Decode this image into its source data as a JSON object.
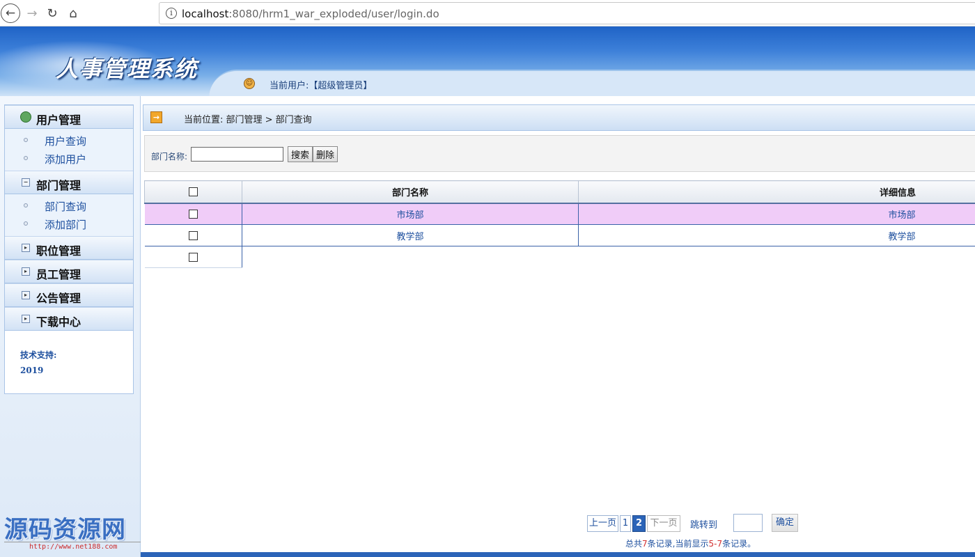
{
  "browser": {
    "url_host": "localhost",
    "url_rest": ":8080/hrm1_war_exploded/user/login.do",
    "info_icon": "i"
  },
  "header": {
    "system_title": "人事管理系统",
    "current_user": "当前用户:【超级管理员】"
  },
  "sidebar": {
    "groups": [
      {
        "label": "用户管理",
        "items": [
          "用户查询",
          "添加用户"
        ]
      },
      {
        "label": "部门管理",
        "items": [
          "部门查询",
          "添加部门"
        ]
      },
      {
        "label": "职位管理"
      },
      {
        "label": "员工管理"
      },
      {
        "label": "公告管理"
      },
      {
        "label": "下载中心"
      }
    ],
    "tech_label": "技术支持:",
    "tech_year": "2019"
  },
  "watermark": {
    "title": "源码资源网",
    "url": "http://www.net188.com"
  },
  "breadcrumb": {
    "text": "当前位置: 部门管理 > 部门查询"
  },
  "search": {
    "label": "部门名称:",
    "value": "",
    "search_button": "搜索",
    "delete_button": "删除"
  },
  "table": {
    "headers": [
      "部门名称",
      "详细信息"
    ],
    "rows": [
      {
        "name": "市场部",
        "detail": "市场部",
        "highlighted": true
      },
      {
        "name": "教学部",
        "detail": "教学部",
        "highlighted": false
      }
    ]
  },
  "pager": {
    "prev": "上一页",
    "page1": "1",
    "page2": "2",
    "next": "下一页",
    "jump_label": "跳转到",
    "go": "确定",
    "summary_prefix": "总共",
    "total": "7",
    "summary_mid": "条记录,当前显示",
    "range": "5-7",
    "summary_suffix": "条记录。"
  },
  "colors": {
    "accent": "#2b64b8",
    "highlight_row": "#f0ccf8",
    "link_blue": "#1d4f9e"
  }
}
